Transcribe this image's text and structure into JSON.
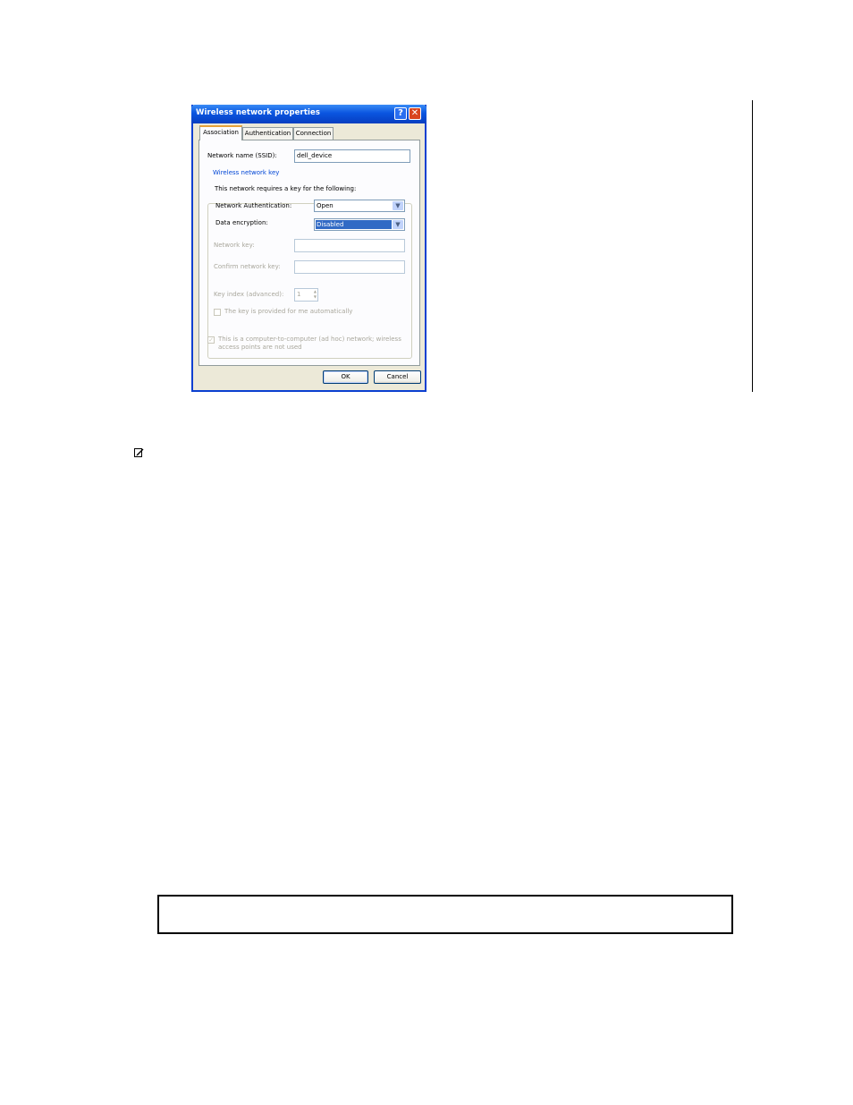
{
  "dialog": {
    "title": "Wireless network properties",
    "help_glyph": "?",
    "close_glyph": "✕",
    "tabs": [
      {
        "label": "Association",
        "active": true
      },
      {
        "label": "Authentication",
        "active": false
      },
      {
        "label": "Connection",
        "active": false
      }
    ],
    "ssid": {
      "label": "Network name (SSID):",
      "value": "dell_device"
    },
    "key_group": {
      "title": "Wireless network key",
      "intro": "This network requires a key for the following:",
      "auth": {
        "label": "Network Authentication:",
        "value": "Open"
      },
      "encryption": {
        "label": "Data encryption:",
        "value": "Disabled"
      },
      "network_key": {
        "label": "Network key:",
        "value": ""
      },
      "confirm_key": {
        "label": "Confirm network key:",
        "value": ""
      },
      "key_index": {
        "label": "Key index (advanced):",
        "value": "1"
      },
      "auto_key": {
        "label": "The key is provided for me automatically",
        "checked": false
      }
    },
    "adhoc": {
      "line1": "This is a computer-to-computer (ad hoc) network; wireless",
      "line2": "access points are not used",
      "checked": true
    },
    "buttons": {
      "ok": "OK",
      "cancel": "Cancel"
    }
  },
  "colors": {
    "titlebar": "#0a55e0",
    "selection": "#316ac5",
    "group_title": "#0046d5",
    "active_tab_accent": "#e5a23b"
  },
  "icons": {
    "note": "pencil-note-icon",
    "dropdown": "chevron-down-icon"
  }
}
